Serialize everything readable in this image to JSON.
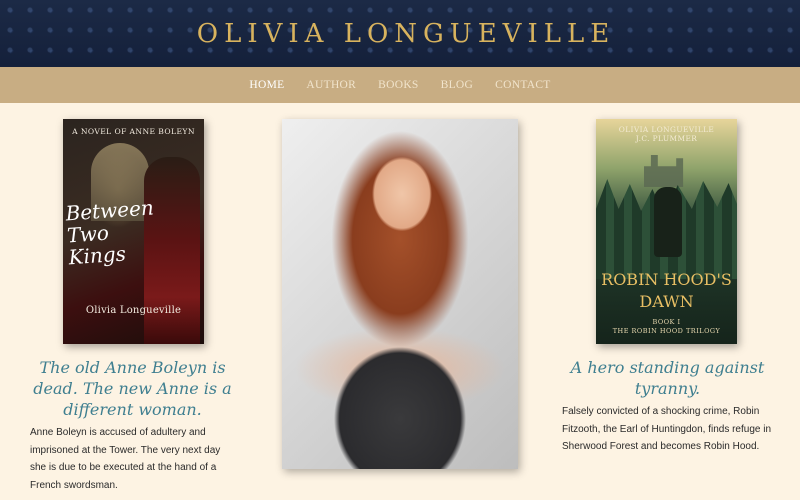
{
  "header": {
    "site_title": "OLIVIA LONGUEVILLE"
  },
  "nav": {
    "items": [
      {
        "label": "HOME",
        "active": true
      },
      {
        "label": "AUTHOR",
        "active": false
      },
      {
        "label": "BOOKS",
        "active": false
      },
      {
        "label": "BLOG",
        "active": false
      },
      {
        "label": "CONTACT",
        "active": false
      }
    ]
  },
  "books": {
    "left": {
      "cover_caption": "A NOVEL OF ANNE BOLEYN",
      "cover_title": "Between Two Kings",
      "cover_author": "Olivia Longueville",
      "tagline": "The old Anne Boleyn is dead. The new Anne is a different woman.",
      "blurb": "Anne Boleyn is accused of adultery and imprisoned at the Tower. The very next day she is due to be executed at the hand of a French swordsman."
    },
    "right": {
      "cover_authors_line1": "OLIVIA LONGUEVILLE",
      "cover_authors_line2": "J.C. PLUMMER",
      "cover_title": "ROBIN HOOD'S DAWN",
      "cover_subtitle_line1": "BOOK I",
      "cover_subtitle_line2": "THE ROBIN HOOD TRILOGY",
      "tagline": "A hero standing against tyranny.",
      "blurb": "Falsely convicted of a shocking crime, Robin Fitzooth, the Earl of Huntingdon, finds refuge in Sherwood Forest and becomes Robin Hood."
    }
  },
  "colors": {
    "header_bg": "#1c2a46",
    "title_gold": "#d8b35e",
    "nav_bg": "#c8ad83",
    "page_bg": "#fdf3e3",
    "tagline_teal": "#3f7f90"
  }
}
